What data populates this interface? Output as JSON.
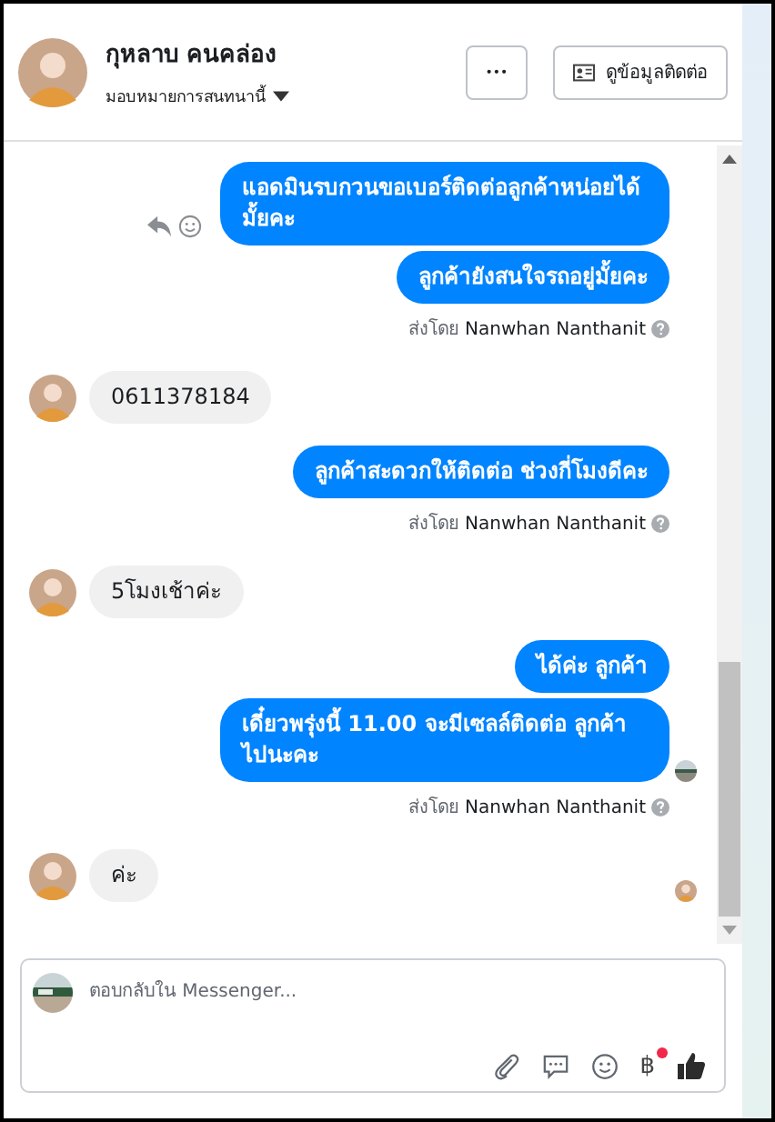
{
  "contact": {
    "name": "กุหลาบ คนคล่อง",
    "assign_label": "มอบหมายการสนทนานี้"
  },
  "header_buttons": {
    "more": "•••",
    "contact_info": "ดูข้อมูลติดต่อ"
  },
  "messages": [
    {
      "kind": "outgoing",
      "text": "แอดมินรบกวนขอเบอร์ติดต่อลูกค้าหน่อยได้มั้ยคะ",
      "actions": true
    },
    {
      "kind": "outgoing",
      "text": "ลูกค้ายังสนใจรถอยู่มั้ยคะ"
    },
    {
      "kind": "sent_by",
      "prefix": "ส่งโดย",
      "name": "Nanwhan Nanthanit"
    },
    {
      "kind": "incoming",
      "text": "0611378184"
    },
    {
      "kind": "outgoing",
      "text": "ลูกค้าสะดวกให้ติดต่อ ช่วงกี่โมงดีคะ"
    },
    {
      "kind": "sent_by",
      "prefix": "ส่งโดย",
      "name": "Nanwhan Nanthanit"
    },
    {
      "kind": "incoming",
      "text": "5โมงเช้าค่ะ"
    },
    {
      "kind": "outgoing",
      "text": "ได้ค่ะ ลูกค้า"
    },
    {
      "kind": "outgoing",
      "text": "เดี๋ยวพรุ่งนี้ 11.00 จะมีเซลล์ติดต่อ ลูกค้าไปนะคะ",
      "seen_marker": true
    },
    {
      "kind": "sent_by",
      "prefix": "ส่งโดย",
      "name": "Nanwhan Nanthanit"
    },
    {
      "kind": "incoming",
      "text": "ค่ะ",
      "seen_marker": true
    }
  ],
  "composer": {
    "placeholder": "ตอบกลับใน Messenger...",
    "payment_glyph": "฿",
    "payment_badge": true
  }
}
